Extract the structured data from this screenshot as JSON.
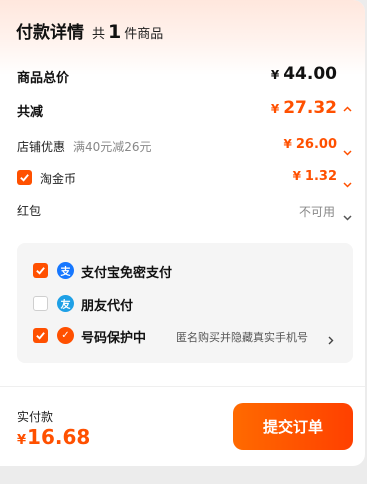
{
  "header": {
    "title": "付款详情",
    "count_prefix": "共",
    "count": "1",
    "count_suffix": "件商品"
  },
  "total": {
    "label": "商品总价",
    "currency": "¥",
    "amount": "44.00"
  },
  "discount": {
    "label": "共减",
    "currency": "¥",
    "amount": "27.32"
  },
  "store_coupon": {
    "label": "店铺优惠",
    "note": "满40元减26元",
    "currency": "¥",
    "amount": "26.00"
  },
  "taojinbi": {
    "label": "淘金币",
    "currency": "¥",
    "amount": "1.32",
    "checked": true
  },
  "hongbao": {
    "label": "红包",
    "status": "不可用"
  },
  "options": [
    {
      "label": "支付宝免密支付",
      "checked": true,
      "icon": "alipay-icon",
      "color": "#1677ff",
      "glyph": "支"
    },
    {
      "label": "朋友代付",
      "checked": false,
      "icon": "friend-pay-icon",
      "color": "#1ea0e6",
      "glyph": "友"
    },
    {
      "label": "号码保护中",
      "checked": true,
      "icon": "shield-icon",
      "color": "#ff5000",
      "glyph": "✓",
      "note": "匿名购买并隐藏真实手机号"
    }
  ],
  "footer": {
    "pay_label": "实付款",
    "currency": "¥",
    "amount": "16.68",
    "submit_label": "提交订单"
  },
  "colors": {
    "accent": "#ff5000",
    "text": "#111111",
    "muted": "#888888"
  }
}
